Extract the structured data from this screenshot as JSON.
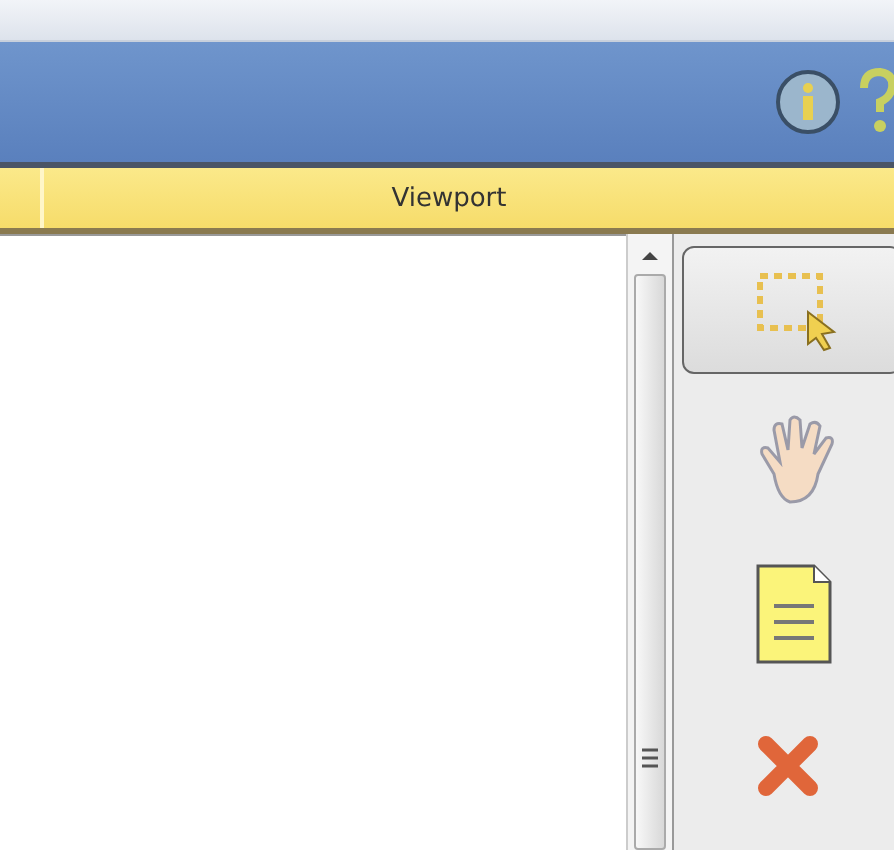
{
  "panel": {
    "title": "Viewport"
  },
  "tools": [
    {
      "kind": "select",
      "selected": true
    },
    {
      "kind": "pan",
      "selected": false
    },
    {
      "kind": "note",
      "selected": false
    },
    {
      "kind": "delete",
      "selected": false
    }
  ]
}
